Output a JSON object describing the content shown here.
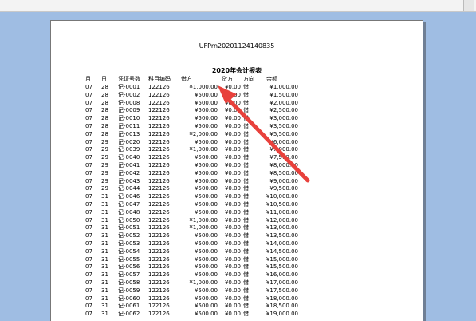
{
  "doc_id": "UFPrn20201124140835",
  "report_title": "2020年会计报表",
  "headers": {
    "month": "月",
    "day": "日",
    "voucher_no": "凭证号数",
    "account_code": "科目编码",
    "debit": "借方",
    "credit": "贷方",
    "direction": "方向",
    "balance": "余额"
  },
  "rows": [
    {
      "month": "07",
      "day": "28",
      "voucher": "记-0001",
      "code": "122126",
      "debit": "¥1,000.00",
      "credit": "¥0.00",
      "dir": "借",
      "balance": "¥1,000.00"
    },
    {
      "month": "07",
      "day": "28",
      "voucher": "记-0002",
      "code": "122126",
      "debit": "¥500.00",
      "credit": "¥0.00",
      "dir": "借",
      "balance": "¥1,500.00"
    },
    {
      "month": "07",
      "day": "28",
      "voucher": "记-0008",
      "code": "122126",
      "debit": "¥500.00",
      "credit": "¥0.00",
      "dir": "借",
      "balance": "¥2,000.00"
    },
    {
      "month": "07",
      "day": "28",
      "voucher": "记-0009",
      "code": "122126",
      "debit": "¥500.00",
      "credit": "¥0.00",
      "dir": "借",
      "balance": "¥2,500.00"
    },
    {
      "month": "07",
      "day": "28",
      "voucher": "记-0010",
      "code": "122126",
      "debit": "¥500.00",
      "credit": "¥0.00",
      "dir": "借",
      "balance": "¥3,000.00"
    },
    {
      "month": "07",
      "day": "28",
      "voucher": "记-0011",
      "code": "122126",
      "debit": "¥500.00",
      "credit": "¥0.00",
      "dir": "借",
      "balance": "¥3,500.00"
    },
    {
      "month": "07",
      "day": "28",
      "voucher": "记-0013",
      "code": "122126",
      "debit": "¥2,000.00",
      "credit": "¥0.00",
      "dir": "借",
      "balance": "¥5,500.00"
    },
    {
      "month": "07",
      "day": "29",
      "voucher": "记-0020",
      "code": "122126",
      "debit": "¥500.00",
      "credit": "¥0.00",
      "dir": "借",
      "balance": "¥6,000.00"
    },
    {
      "month": "07",
      "day": "29",
      "voucher": "记-0039",
      "code": "122126",
      "debit": "¥1,000.00",
      "credit": "¥0.00",
      "dir": "借",
      "balance": "¥7,000.00"
    },
    {
      "month": "07",
      "day": "29",
      "voucher": "记-0040",
      "code": "122126",
      "debit": "¥500.00",
      "credit": "¥0.00",
      "dir": "借",
      "balance": "¥7,500.00"
    },
    {
      "month": "07",
      "day": "29",
      "voucher": "记-0041",
      "code": "122126",
      "debit": "¥500.00",
      "credit": "¥0.00",
      "dir": "借",
      "balance": "¥8,000.00"
    },
    {
      "month": "07",
      "day": "29",
      "voucher": "记-0042",
      "code": "122126",
      "debit": "¥500.00",
      "credit": "¥0.00",
      "dir": "借",
      "balance": "¥8,500.00"
    },
    {
      "month": "07",
      "day": "29",
      "voucher": "记-0043",
      "code": "122126",
      "debit": "¥500.00",
      "credit": "¥0.00",
      "dir": "借",
      "balance": "¥9,000.00"
    },
    {
      "month": "07",
      "day": "29",
      "voucher": "记-0044",
      "code": "122126",
      "debit": "¥500.00",
      "credit": "¥0.00",
      "dir": "借",
      "balance": "¥9,500.00"
    },
    {
      "month": "07",
      "day": "31",
      "voucher": "记-0046",
      "code": "122126",
      "debit": "¥500.00",
      "credit": "¥0.00",
      "dir": "借",
      "balance": "¥10,000.00"
    },
    {
      "month": "07",
      "day": "31",
      "voucher": "记-0047",
      "code": "122126",
      "debit": "¥500.00",
      "credit": "¥0.00",
      "dir": "借",
      "balance": "¥10,500.00"
    },
    {
      "month": "07",
      "day": "31",
      "voucher": "记-0048",
      "code": "122126",
      "debit": "¥500.00",
      "credit": "¥0.00",
      "dir": "借",
      "balance": "¥11,000.00"
    },
    {
      "month": "07",
      "day": "31",
      "voucher": "记-0050",
      "code": "122126",
      "debit": "¥1,000.00",
      "credit": "¥0.00",
      "dir": "借",
      "balance": "¥12,000.00"
    },
    {
      "month": "07",
      "day": "31",
      "voucher": "记-0051",
      "code": "122126",
      "debit": "¥1,000.00",
      "credit": "¥0.00",
      "dir": "借",
      "balance": "¥13,000.00"
    },
    {
      "month": "07",
      "day": "31",
      "voucher": "记-0052",
      "code": "122126",
      "debit": "¥500.00",
      "credit": "¥0.00",
      "dir": "借",
      "balance": "¥13,500.00"
    },
    {
      "month": "07",
      "day": "31",
      "voucher": "记-0053",
      "code": "122126",
      "debit": "¥500.00",
      "credit": "¥0.00",
      "dir": "借",
      "balance": "¥14,000.00"
    },
    {
      "month": "07",
      "day": "31",
      "voucher": "记-0054",
      "code": "122126",
      "debit": "¥500.00",
      "credit": "¥0.00",
      "dir": "借",
      "balance": "¥14,500.00"
    },
    {
      "month": "07",
      "day": "31",
      "voucher": "记-0055",
      "code": "122126",
      "debit": "¥500.00",
      "credit": "¥0.00",
      "dir": "借",
      "balance": "¥15,000.00"
    },
    {
      "month": "07",
      "day": "31",
      "voucher": "记-0056",
      "code": "122126",
      "debit": "¥500.00",
      "credit": "¥0.00",
      "dir": "借",
      "balance": "¥15,500.00"
    },
    {
      "month": "07",
      "day": "31",
      "voucher": "记-0057",
      "code": "122126",
      "debit": "¥500.00",
      "credit": "¥0.00",
      "dir": "借",
      "balance": "¥16,000.00"
    },
    {
      "month": "07",
      "day": "31",
      "voucher": "记-0058",
      "code": "122126",
      "debit": "¥1,000.00",
      "credit": "¥0.00",
      "dir": "借",
      "balance": "¥17,000.00"
    },
    {
      "month": "07",
      "day": "31",
      "voucher": "记-0059",
      "code": "122126",
      "debit": "¥500.00",
      "credit": "¥0.00",
      "dir": "借",
      "balance": "¥17,500.00"
    },
    {
      "month": "07",
      "day": "31",
      "voucher": "记-0060",
      "code": "122126",
      "debit": "¥500.00",
      "credit": "¥0.00",
      "dir": "借",
      "balance": "¥18,000.00"
    },
    {
      "month": "07",
      "day": "31",
      "voucher": "记-0061",
      "code": "122126",
      "debit": "¥500.00",
      "credit": "¥0.00",
      "dir": "借",
      "balance": "¥18,500.00"
    },
    {
      "month": "07",
      "day": "31",
      "voucher": "记-0062",
      "code": "122126",
      "debit": "¥500.00",
      "credit": "¥0.00",
      "dir": "借",
      "balance": "¥19,000.00"
    }
  ],
  "annotation": {
    "arrow_color": "#e8413c"
  },
  "colors": {
    "desktop_bg": "#9fbde3",
    "page_bg": "#ffffff"
  }
}
